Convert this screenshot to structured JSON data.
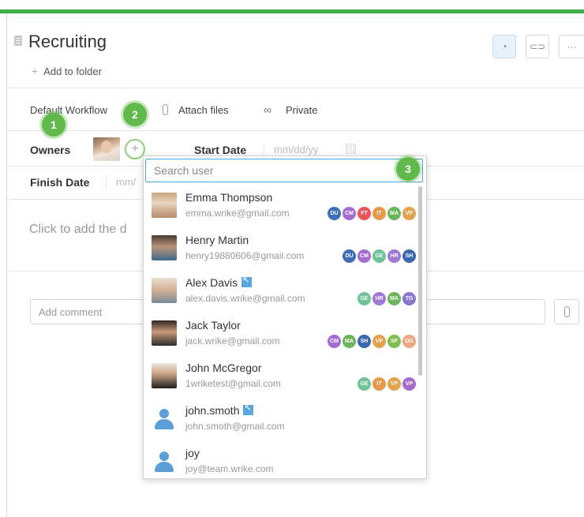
{
  "header": {
    "title": "Recruiting",
    "add_to_folder": "Add to folder",
    "rss_icon": "rss-icon",
    "link_icon": "link-icon",
    "more_label": "···"
  },
  "toolbar": {
    "workflow": "Default Workflow",
    "attach": "Attach files",
    "privacy": "Private"
  },
  "fields": {
    "owners_label": "Owners",
    "start_label": "Start Date",
    "start_placeholder": "mm/dd/yy",
    "finish_label": "Finish Date",
    "finish_placeholder": "mm/"
  },
  "description_placeholder": "Click to add the d",
  "comment_placeholder": "Add comment",
  "badges": [
    "1",
    "2",
    "3"
  ],
  "dropdown": {
    "search_placeholder": "Search user",
    "users": [
      {
        "name": "Emma Thompson",
        "email": "emma.wrike@gmail.com",
        "external": false,
        "tags": [
          {
            "t": "DU",
            "c": "#3e6fb6"
          },
          {
            "t": "CM",
            "c": "#a46cd1"
          },
          {
            "t": "FT",
            "c": "#e8545c"
          },
          {
            "t": "IT",
            "c": "#e79a4a"
          },
          {
            "t": "MA",
            "c": "#6db55b"
          },
          {
            "t": "VP",
            "c": "#e5a24e"
          }
        ]
      },
      {
        "name": "Henry Martin",
        "email": "henry19880606@gmail.com",
        "external": false,
        "tags": [
          {
            "t": "DU",
            "c": "#3e6fb6"
          },
          {
            "t": "CM",
            "c": "#a46cd1"
          },
          {
            "t": "GE",
            "c": "#6ec39a"
          },
          {
            "t": "HR",
            "c": "#9e7ad6"
          },
          {
            "t": "SH",
            "c": "#3b66b0"
          }
        ]
      },
      {
        "name": "Alex Davis",
        "email": "alex.davis.wrike@gmail.com",
        "external": true,
        "tags": [
          {
            "t": "GE",
            "c": "#6ec39a"
          },
          {
            "t": "HR",
            "c": "#9e7ad6"
          },
          {
            "t": "MA",
            "c": "#6db55b"
          },
          {
            "t": "TG",
            "c": "#8a76d0"
          }
        ]
      },
      {
        "name": "Jack Taylor",
        "email": "jack.wrike@gmail.com",
        "external": false,
        "tags": [
          {
            "t": "CM",
            "c": "#a46cd1"
          },
          {
            "t": "MA",
            "c": "#6db55b"
          },
          {
            "t": "SH",
            "c": "#3b66b0"
          },
          {
            "t": "VP",
            "c": "#e5a24e"
          },
          {
            "t": "SF",
            "c": "#7fbf4f"
          },
          {
            "t": "DG",
            "c": "#e9a87d"
          }
        ]
      },
      {
        "name": "John McGregor",
        "email": "1wriketest@gmail.com",
        "external": false,
        "tags": [
          {
            "t": "GE",
            "c": "#6ec39a"
          },
          {
            "t": "IT",
            "c": "#e79a4a"
          },
          {
            "t": "VP",
            "c": "#e5a24e"
          },
          {
            "t": "VP",
            "c": "#a46cd1"
          }
        ]
      },
      {
        "name": "john.smoth",
        "email": "john.smoth@gmail.com",
        "external": true,
        "tags": []
      },
      {
        "name": "joy",
        "email": "joy@team.wrike.com",
        "external": false,
        "tags": []
      }
    ]
  },
  "colors": {
    "accent": "#3fae49",
    "badge": "#60b94a",
    "focus": "#4aa3df"
  }
}
